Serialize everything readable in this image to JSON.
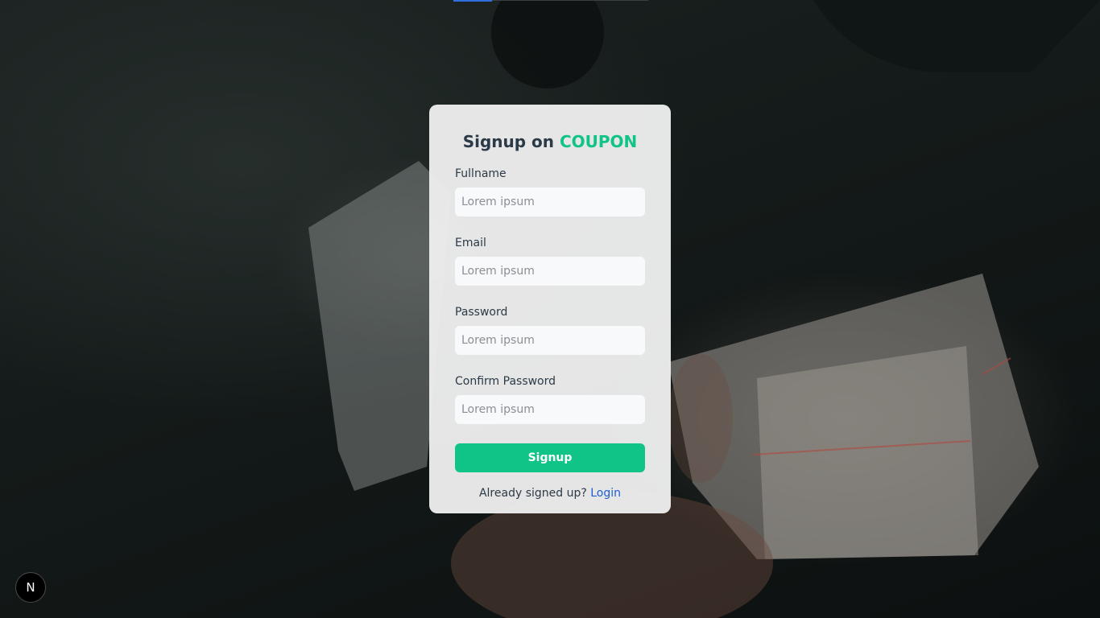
{
  "title": {
    "prefix": "Signup on ",
    "brand": "COUPON"
  },
  "colors": {
    "brand": "#10c387",
    "link": "#1d5fd3",
    "card": "#eeeeee"
  },
  "form": {
    "fields": [
      {
        "label": "Fullname",
        "placeholder": "Lorem ipsum"
      },
      {
        "label": "Email",
        "placeholder": "Lorem ipsum"
      },
      {
        "label": "Password",
        "placeholder": "Lorem ipsum"
      },
      {
        "label": "Confirm Password",
        "placeholder": "Lorem ipsum"
      }
    ],
    "submit_label": "Signup"
  },
  "footer": {
    "text": "Already signed up? ",
    "link_label": "Login"
  },
  "badge": {
    "label": "N",
    "icon": "nextjs-logo-icon"
  }
}
